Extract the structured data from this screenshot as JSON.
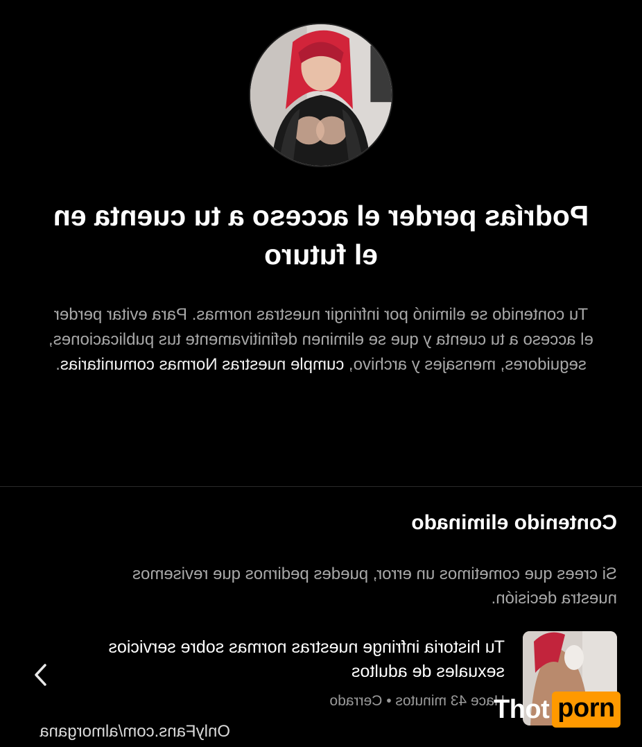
{
  "warning": {
    "title": "Podrías perder el acceso a tu cuenta en el futuro",
    "body_prefix": "Tu contenido se eliminó por infringir nuestras normas. Para evitar perder el acceso a tu cuenta y que se eliminen definitivamente tus publicaciones, seguidores, mensajes y archivo, ",
    "body_link": "cumple nuestras Normas comunitarias",
    "body_suffix": "."
  },
  "removed": {
    "section_title": "Contenido eliminado",
    "section_desc": "Si crees que cometimos un error, puedes pedirnos que revisemos nuestra decisión.",
    "item": {
      "title": "Tu historia infringe nuestras normas sobre servicios sexuales de adultos",
      "time": "Hace 43 minutos",
      "separator": "•",
      "status": "Cerrado"
    }
  },
  "watermark": {
    "url": "OnlyFans.com/almorgana",
    "logo_part1": "Thot",
    "logo_part2": "porn"
  },
  "icons": {
    "chevron": "chevron-right-icon"
  },
  "colors": {
    "background": "#000000",
    "muted_text": "#a8a8a8",
    "logo_accent": "#ff9900"
  }
}
